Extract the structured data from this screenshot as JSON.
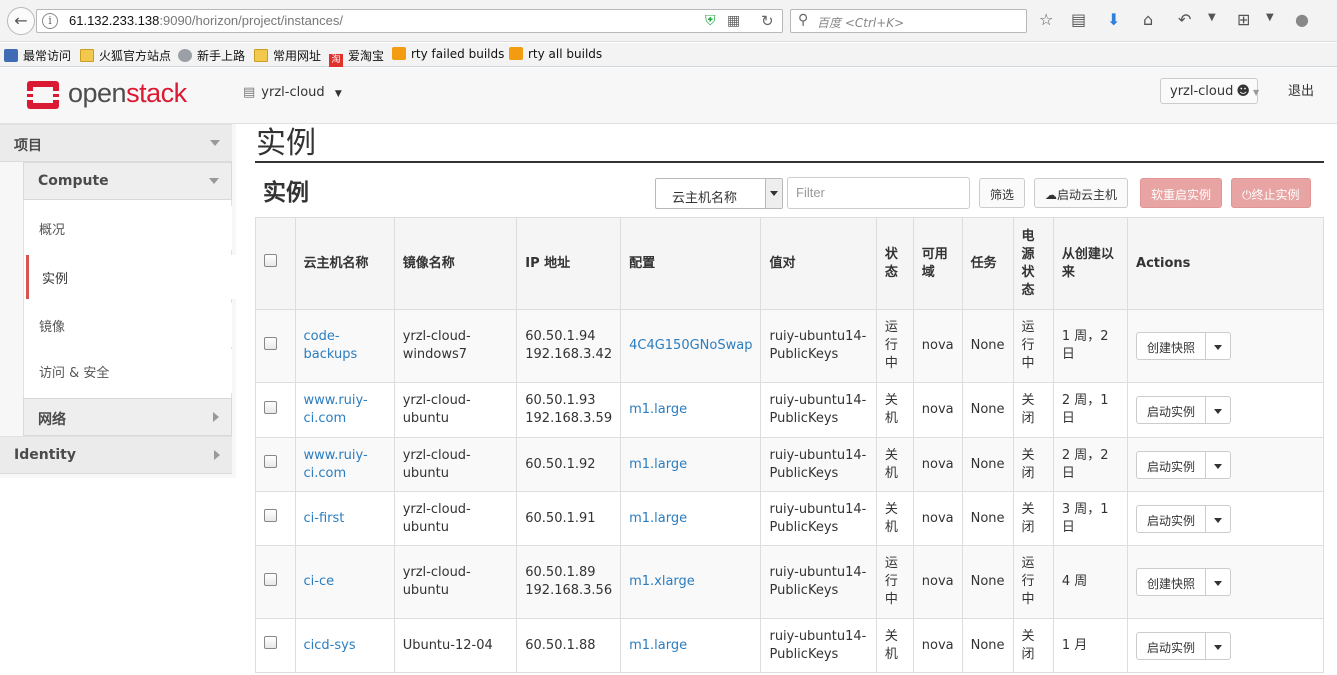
{
  "browser": {
    "url_host": "61.132.233.138",
    "url_rest": ":9090/horizon/project/instances/",
    "search_placeholder": "百度 <Ctrl+K>",
    "bookmarks": [
      {
        "label": "最常访问",
        "icon": "folder"
      },
      {
        "label": "火狐官方站点",
        "icon": "folder"
      },
      {
        "label": "新手上路",
        "icon": "globe"
      },
      {
        "label": "常用网址",
        "icon": "folder"
      },
      {
        "label": "爱淘宝",
        "icon": "red"
      },
      {
        "label": "rty failed builds",
        "icon": "rss"
      },
      {
        "label": "rty all builds",
        "icon": "rss"
      }
    ]
  },
  "header": {
    "logo_open": "open",
    "logo_stack": "stack",
    "project": "yrzl-cloud",
    "user": "yrzl-cloud",
    "logout": "退出"
  },
  "sidebar": {
    "project": "项目",
    "compute": "Compute",
    "items": [
      "概况",
      "实例",
      "镜像",
      "访问 & 安全"
    ],
    "network": "网络",
    "identity": "Identity"
  },
  "main": {
    "page_title": "实例",
    "section_title": "实例",
    "filter_field": "云主机名称",
    "filter_placeholder": "Filter",
    "filter_button": "筛选",
    "launch_button": "启动云主机",
    "soft_reboot_button": "软重启实例",
    "terminate_button": "终止实例"
  },
  "table": {
    "headers": [
      "云主机名称",
      "镜像名称",
      "IP 地址",
      "配置",
      "值对",
      "状态",
      "可用域",
      "任务",
      "电源状态",
      "从创建以来",
      "Actions"
    ],
    "rows": [
      {
        "name": "code-backups",
        "image": "yrzl-cloud-windows7",
        "ip": "60.50.1.94\n192.168.3.42",
        "flavor": "4C4G150GNoSwap",
        "keypair": "ruiy-ubuntu14-PublicKeys",
        "status": "运行中",
        "az": "nova",
        "task": "None",
        "power": "运行中",
        "age": "1 周，2 日",
        "action": "创建快照"
      },
      {
        "name": "www.ruiy-ci.com",
        "image": "yrzl-cloud-ubuntu",
        "ip": "60.50.1.93\n192.168.3.59",
        "flavor": "m1.large",
        "keypair": "ruiy-ubuntu14-PublicKeys",
        "status": "关机",
        "az": "nova",
        "task": "None",
        "power": "关闭",
        "age": "2 周，1 日",
        "action": "启动实例"
      },
      {
        "name": "www.ruiy-ci.com",
        "image": "yrzl-cloud-ubuntu",
        "ip": "60.50.1.92",
        "flavor": "m1.large",
        "keypair": "ruiy-ubuntu14-PublicKeys",
        "status": "关机",
        "az": "nova",
        "task": "None",
        "power": "关闭",
        "age": "2 周，2 日",
        "action": "启动实例"
      },
      {
        "name": "ci-first",
        "image": "yrzl-cloud-ubuntu",
        "ip": "60.50.1.91",
        "flavor": "m1.large",
        "keypair": "ruiy-ubuntu14-PublicKeys",
        "status": "关机",
        "az": "nova",
        "task": "None",
        "power": "关闭",
        "age": "3 周，1 日",
        "action": "启动实例"
      },
      {
        "name": "ci-ce",
        "image": "yrzl-cloud-ubuntu",
        "ip": "60.50.1.89\n192.168.3.56",
        "flavor": "m1.xlarge",
        "keypair": "ruiy-ubuntu14-PublicKeys",
        "status": "运行中",
        "az": "nova",
        "task": "None",
        "power": "运行中",
        "age": "4 周",
        "action": "创建快照"
      },
      {
        "name": "cicd-sys",
        "image": "Ubuntu-12-04",
        "ip": "60.50.1.88",
        "flavor": "m1.large",
        "keypair": "ruiy-ubuntu14-PublicKeys",
        "status": "关机",
        "az": "nova",
        "task": "None",
        "power": "关闭",
        "age": "1 月",
        "action": "启动实例"
      }
    ]
  },
  "colors": {
    "brand_red": "#da1a32",
    "link": "#2a7dc0",
    "danger_btn": "#e8a3a3"
  }
}
